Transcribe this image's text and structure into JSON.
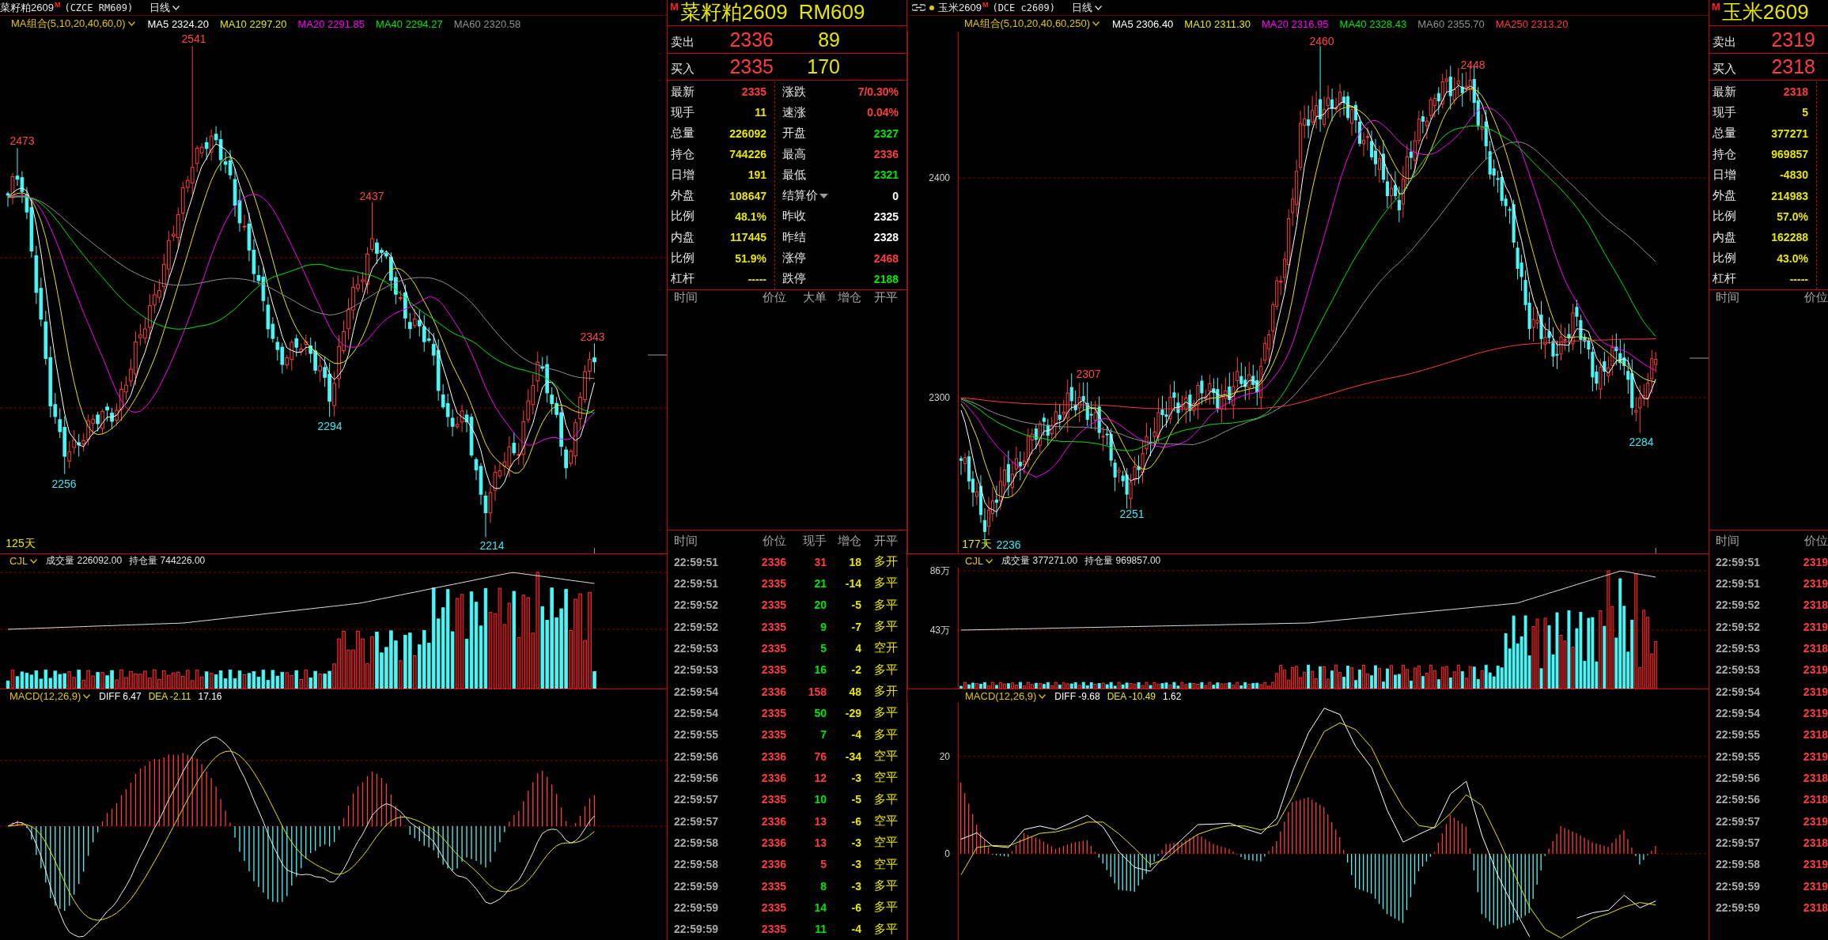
{
  "left_chart": {
    "title_bar": {
      "name": "菜籽粕2609",
      "badge": "M",
      "code": "(CZCE RM609)",
      "period": "日线",
      "linked": false,
      "marked": false
    },
    "ma_legend": {
      "label": "MA组合(5,10,20,40,60,0)",
      "items": [
        {
          "name": "MA5",
          "value": "2324.20",
          "color": "#ffffff"
        },
        {
          "name": "MA10",
          "value": "2297.20",
          "color": "#e6e600"
        },
        {
          "name": "MA20",
          "value": "2291.85",
          "color": "#ff00ff"
        },
        {
          "name": "MA40",
          "value": "2294.27",
          "color": "#00e600"
        },
        {
          "name": "MA60",
          "value": "2320.58",
          "color": "#909090"
        }
      ]
    },
    "price_annotations": [
      {
        "text": "2541",
        "kind": "high"
      },
      {
        "text": "2473",
        "kind": "high"
      },
      {
        "text": "2437",
        "kind": "high"
      },
      {
        "text": "2343",
        "kind": "high"
      },
      {
        "text": "2294",
        "kind": "low"
      },
      {
        "text": "2256",
        "kind": "low"
      },
      {
        "text": "2214",
        "kind": "low"
      }
    ],
    "range_label": "125天",
    "volume_panel": {
      "indicator": "CJL",
      "items": [
        {
          "label": "成交量",
          "value": "226092.00"
        },
        {
          "label": "持仓量",
          "value": "744226.00"
        }
      ]
    },
    "macd_panel": {
      "indicator": "MACD(12,26,9)",
      "items": [
        {
          "label": "DIFF",
          "value": "6.47",
          "color": "#ffffff"
        },
        {
          "label": "DEA",
          "value": "-2.11",
          "color": "#e6e600"
        },
        {
          "value": "17.16",
          "color": "#ffffff"
        }
      ]
    }
  },
  "left_quote": {
    "badge": "M",
    "title": "菜籽粕2609",
    "code": "RM609",
    "ask": {
      "label": "卖出",
      "price": "2336",
      "volume": "89"
    },
    "bid": {
      "label": "买入",
      "price": "2335",
      "volume": "170"
    },
    "stats_left": [
      {
        "label": "最新",
        "value": "2335",
        "color": "#ff3c3c"
      },
      {
        "label": "现手",
        "value": "11",
        "color": "#e6e600"
      },
      {
        "label": "总量",
        "value": "226092",
        "color": "#e6e600"
      },
      {
        "label": "持仓",
        "value": "744226",
        "color": "#e6e600"
      },
      {
        "label": "日增",
        "value": "191",
        "color": "#e6e600"
      },
      {
        "label": "外盘",
        "value": "108647",
        "color": "#e6e600"
      },
      {
        "label": "比例",
        "value": "48.1%",
        "color": "#e6e600"
      },
      {
        "label": "内盘",
        "value": "117445",
        "color": "#e6e600"
      },
      {
        "label": "比例",
        "value": "51.9%",
        "color": "#e6e600"
      },
      {
        "label": "杠杆",
        "value": "-----",
        "color": "#e6e600"
      }
    ],
    "stats_right": [
      {
        "label": "涨跌",
        "value": "7/0.30%",
        "color": "#ff3c3c",
        "kind": "plain"
      },
      {
        "label": "速涨",
        "value": "0.04%",
        "color": "#ff3c3c",
        "kind": "plain"
      },
      {
        "label": "开盘",
        "value": "2327",
        "color": "#00e600",
        "kind": "plain"
      },
      {
        "label": "最高",
        "value": "2336",
        "color": "#ff3c3c",
        "kind": "plain"
      },
      {
        "label": "最低",
        "value": "2321",
        "color": "#00e600",
        "kind": "plain"
      },
      {
        "label": "结算价",
        "value": "0",
        "color": "#ffffff",
        "kind": "dropdown"
      },
      {
        "label": "昨收",
        "value": "2325",
        "color": "#ffffff",
        "kind": "plain"
      },
      {
        "label": "昨结",
        "value": "2328",
        "color": "#ffffff",
        "kind": "plain"
      },
      {
        "label": "涨停",
        "value": "2468",
        "color": "#ff3c3c",
        "kind": "plain"
      },
      {
        "label": "跌停",
        "value": "2188",
        "color": "#00e600",
        "kind": "plain"
      }
    ],
    "big_orders": {
      "columns": [
        "时间",
        "价位",
        "大单",
        "增仓",
        "开平"
      ]
    },
    "ticks": {
      "columns": [
        "时间",
        "价位",
        "现手",
        "增仓",
        "开平"
      ],
      "rows": [
        {
          "time": "22:59:51",
          "price": "2336",
          "volume": "31",
          "color": "#ff3c3c",
          "change": "18",
          "action": "多开"
        },
        {
          "time": "22:59:51",
          "price": "2335",
          "volume": "21",
          "color": "#00e600",
          "change": "-14",
          "action": "多平"
        },
        {
          "time": "22:59:52",
          "price": "2335",
          "volume": "20",
          "color": "#00e600",
          "change": "-5",
          "action": "多平"
        },
        {
          "time": "22:59:52",
          "price": "2335",
          "volume": "9",
          "color": "#00e600",
          "change": "-7",
          "action": "多平"
        },
        {
          "time": "22:59:53",
          "price": "2335",
          "volume": "5",
          "color": "#00e600",
          "change": "4",
          "action": "空开"
        },
        {
          "time": "22:59:53",
          "price": "2335",
          "volume": "16",
          "color": "#00e600",
          "change": "-2",
          "action": "多平"
        },
        {
          "time": "22:59:54",
          "price": "2336",
          "volume": "158",
          "color": "#ff3c3c",
          "change": "48",
          "action": "多开"
        },
        {
          "time": "22:59:54",
          "price": "2335",
          "volume": "50",
          "color": "#00e600",
          "change": "-29",
          "action": "多平"
        },
        {
          "time": "22:59:55",
          "price": "2335",
          "volume": "7",
          "color": "#00e600",
          "change": "-4",
          "action": "多平"
        },
        {
          "time": "22:59:56",
          "price": "2336",
          "volume": "76",
          "color": "#ff3c3c",
          "change": "-34",
          "action": "空平"
        },
        {
          "time": "22:59:56",
          "price": "2336",
          "volume": "12",
          "color": "#ff3c3c",
          "change": "-3",
          "action": "空平"
        },
        {
          "time": "22:59:57",
          "price": "2335",
          "volume": "10",
          "color": "#00e600",
          "change": "-5",
          "action": "多平"
        },
        {
          "time": "22:59:57",
          "price": "2336",
          "volume": "13",
          "color": "#ff3c3c",
          "change": "-6",
          "action": "空平"
        },
        {
          "time": "22:59:58",
          "price": "2336",
          "volume": "13",
          "color": "#ff3c3c",
          "change": "-3",
          "action": "空平"
        },
        {
          "time": "22:59:58",
          "price": "2336",
          "volume": "5",
          "color": "#ff3c3c",
          "change": "-3",
          "action": "空平"
        },
        {
          "time": "22:59:59",
          "price": "2335",
          "volume": "8",
          "color": "#00e600",
          "change": "-3",
          "action": "多平"
        },
        {
          "time": "22:59:59",
          "price": "2335",
          "volume": "14",
          "color": "#00e600",
          "change": "-6",
          "action": "多平"
        },
        {
          "time": "22:59:59",
          "price": "2335",
          "volume": "11",
          "color": "#00e600",
          "change": "-4",
          "action": "多平"
        }
      ]
    }
  },
  "right_chart": {
    "title_bar": {
      "name": "玉米2609",
      "badge": "M",
      "code": "(DCE c2609)",
      "period": "日线",
      "linked": true,
      "marked": true
    },
    "ma_legend": {
      "label": "MA组合(5,10,20,40,60,250)",
      "items": [
        {
          "name": "MA5",
          "value": "2306.40",
          "color": "#ffffff"
        },
        {
          "name": "MA10",
          "value": "2311.30",
          "color": "#e6e600"
        },
        {
          "name": "MA20",
          "value": "2316.95",
          "color": "#ff00ff"
        },
        {
          "name": "MA40",
          "value": "2328.43",
          "color": "#00e600"
        },
        {
          "name": "MA60",
          "value": "2355.70",
          "color": "#909090"
        },
        {
          "name": "MA250",
          "value": "2313.20",
          "color": "#ff3c3c"
        }
      ]
    },
    "price_axis": [
      "2400",
      "2300"
    ],
    "price_annotations": [
      {
        "text": "2460",
        "kind": "high"
      },
      {
        "text": "2448",
        "kind": "high"
      },
      {
        "text": "2307",
        "kind": "high"
      },
      {
        "text": "2284",
        "kind": "low"
      },
      {
        "text": "2251",
        "kind": "low"
      },
      {
        "text": "2236",
        "kind": "low"
      }
    ],
    "range_label": "177天",
    "volume_axis": [
      "86万",
      "43万"
    ],
    "volume_panel": {
      "indicator": "CJL",
      "items": [
        {
          "label": "成交量",
          "value": "377271.00"
        },
        {
          "label": "持仓量",
          "value": "969857.00"
        }
      ]
    },
    "macd_panel": {
      "indicator": "MACD(12,26,9)",
      "items": [
        {
          "label": "DIFF",
          "value": "-9.68",
          "color": "#ffffff"
        },
        {
          "label": "DEA",
          "value": "-10.49",
          "color": "#e6e600"
        },
        {
          "value": "1.62",
          "color": "#ffffff"
        }
      ],
      "chart_data": {
        "type": "line",
        "series": [
          {
            "color": "#ffffff",
            "values": [
              3.0,
              4.3,
              1.6,
              1.3,
              5.0,
              5.7,
              5.0,
              6.4,
              7.9,
              5.5,
              0.4,
              -2.8,
              -3.6,
              0.0,
              3.0,
              6.0,
              6.1,
              6.3,
              5.1,
              4.1,
              7.3,
              17.0,
              24.8,
              29.9,
              28.6,
              22.0,
              17.7,
              8.9,
              2.4,
              4.0,
              5.5,
              12.3,
              14.9,
              3.7,
              -4.4,
              -11.0,
              -17.0,
              null,
              null,
              -13.2,
              -12.1,
              -11.6,
              -8.5,
              -11.1,
              -9.7
            ]
          },
          {
            "color": "#e6e600",
            "values": [
              -4.3,
              1.3,
              1.7,
              1.6,
              2.9,
              4.2,
              4.5,
              5.3,
              6.5,
              6.5,
              4.1,
              1.1,
              -2.2,
              -1.0,
              1.8,
              4.0,
              5.1,
              5.8,
              5.7,
              4.9,
              6.0,
              11.7,
              19.0,
              25.1,
              26.9,
              25.5,
              21.8,
              15.1,
              9.5,
              5.8,
              5.3,
              8.3,
              12.1,
              9.9,
              3.3,
              -3.9,
              -10.9,
              -15.5,
              -17.3,
              -15.3,
              -13.3,
              -12.3,
              -10.9,
              -10.0,
              -10.5
            ]
          }
        ],
        "ylim": [
          -17.7,
          31
        ],
        "yticks": [
          0,
          20
        ]
      }
    }
  },
  "right_quote": {
    "badge": "M",
    "title": "玉米2609",
    "ask": {
      "label": "卖出",
      "price": "2319"
    },
    "bid": {
      "label": "买入",
      "price": "2318"
    },
    "stats_left": [
      {
        "label": "最新",
        "value": "2318",
        "color": "#ff3c3c"
      },
      {
        "label": "现手",
        "value": "5",
        "color": "#e6e600"
      },
      {
        "label": "总量",
        "value": "377271",
        "color": "#e6e600"
      },
      {
        "label": "持仓",
        "value": "969857",
        "color": "#e6e600"
      },
      {
        "label": "日增",
        "value": "-4830",
        "color": "#e6e600"
      },
      {
        "label": "外盘",
        "value": "214983",
        "color": "#e6e600"
      },
      {
        "label": "比例",
        "value": "57.0%",
        "color": "#e6e600"
      },
      {
        "label": "内盘",
        "value": "162288",
        "color": "#e6e600"
      },
      {
        "label": "比例",
        "value": "43.0%",
        "color": "#e6e600"
      },
      {
        "label": "杠杆",
        "value": "-----",
        "color": "#e6e600"
      }
    ],
    "big_orders": {
      "columns": [
        "时间",
        "价位"
      ]
    },
    "ticks": {
      "columns": [
        "时间",
        "价位"
      ],
      "rows": [
        {
          "time": "22:59:51",
          "price": "2319"
        },
        {
          "time": "22:59:51",
          "price": "2319"
        },
        {
          "time": "22:59:52",
          "price": "2318"
        },
        {
          "time": "22:59:52",
          "price": "2319"
        },
        {
          "time": "22:59:53",
          "price": "2318"
        },
        {
          "time": "22:59:53",
          "price": "2319"
        },
        {
          "time": "22:59:54",
          "price": "2319"
        },
        {
          "time": "22:59:54",
          "price": "2319"
        },
        {
          "time": "22:59:55",
          "price": "2318"
        },
        {
          "time": "22:59:55",
          "price": "2319"
        },
        {
          "time": "22:59:56",
          "price": "2318"
        },
        {
          "time": "22:59:56",
          "price": "2318"
        },
        {
          "time": "22:59:57",
          "price": "2319"
        },
        {
          "time": "22:59:57",
          "price": "2318"
        },
        {
          "time": "22:59:58",
          "price": "2319"
        },
        {
          "time": "22:59:59",
          "price": "2319"
        },
        {
          "time": "22:59:59",
          "price": "2318"
        }
      ]
    }
  }
}
